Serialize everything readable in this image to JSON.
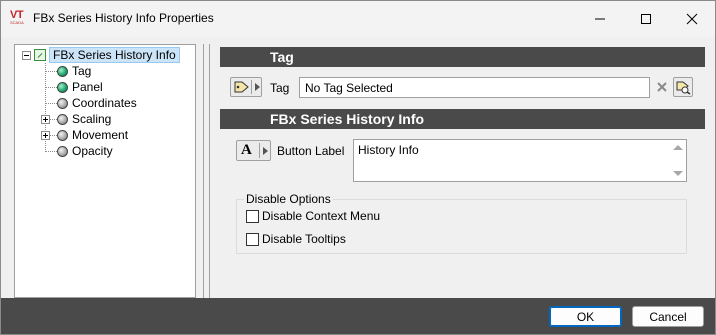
{
  "window": {
    "title": "FBx Series History Info Properties",
    "logo_text": "VT",
    "logo_subtext": "SCADA"
  },
  "tree": {
    "root_label": "FBx Series History Info",
    "items": [
      {
        "label": "Tag",
        "status": "green",
        "expandable": false
      },
      {
        "label": "Panel",
        "status": "green",
        "expandable": false
      },
      {
        "label": "Coordinates",
        "status": "gray",
        "expandable": false
      },
      {
        "label": "Scaling",
        "status": "gray",
        "expandable": true
      },
      {
        "label": "Movement",
        "status": "gray",
        "expandable": true
      },
      {
        "label": "Opacity",
        "status": "gray",
        "expandable": false
      }
    ]
  },
  "tag_section": {
    "header": "Tag",
    "field_label": "Tag",
    "field_value": "No Tag Selected"
  },
  "info_section": {
    "header": "FBx Series History Info",
    "button_label_caption": "Button Label",
    "button_label_value": "History Info",
    "font_glyph": "A"
  },
  "disable_options": {
    "title": "Disable Options",
    "context_menu_label": "Disable Context Menu",
    "context_menu_checked": false,
    "tooltips_label": "Disable Tooltips",
    "tooltips_checked": false
  },
  "footer": {
    "ok_label": "OK",
    "cancel_label": "Cancel"
  },
  "colors": {
    "section_header_bg": "#4a4a4a",
    "selection_bg": "#cce4f7",
    "ok_border": "#0067c0",
    "logo": "#c0282d"
  }
}
